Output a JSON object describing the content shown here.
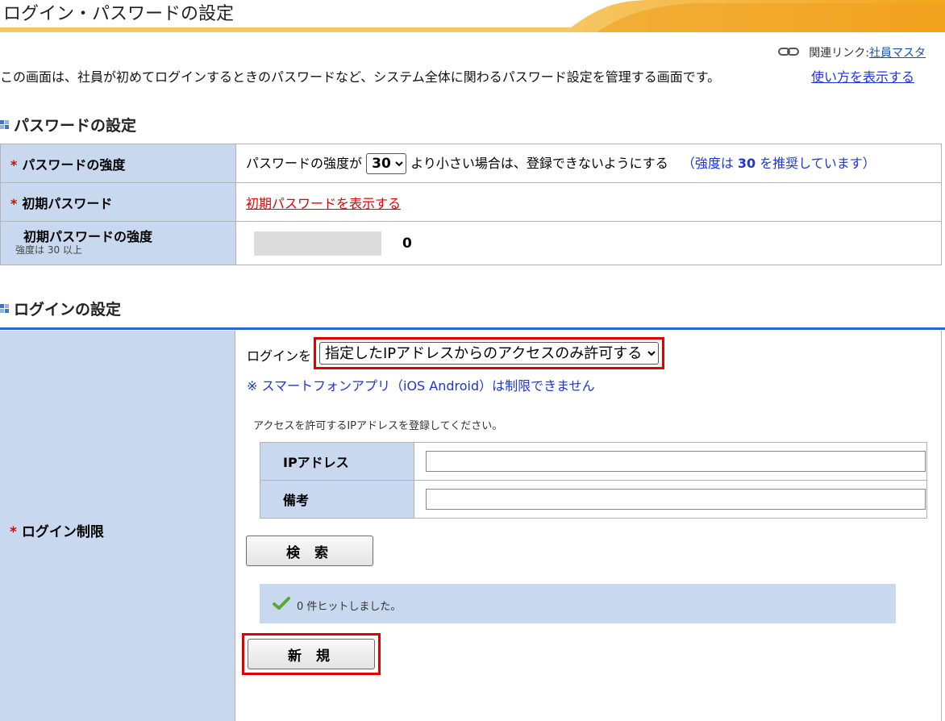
{
  "header": {
    "title": "ログイン・パスワードの設定"
  },
  "related": {
    "prefix": "関連リンク:",
    "link": "社員マスタ"
  },
  "description": "この画面は、社員が初めてログインするときのパスワードなど、システム全体に関わるパスワード設定を管理する画面です。",
  "howto_link": "使い方を表示する",
  "password_section": {
    "title": "パスワードの設定",
    "rows": {
      "strength": {
        "label": "パスワードの強度",
        "text_before": "パスワードの強度が",
        "select_value": "30",
        "text_after": "より小さい場合は、登録できないようにする",
        "recommend_before": "（強度は ",
        "recommend_value": "30",
        "recommend_after": " を推奨しています）"
      },
      "initial": {
        "label": "初期パスワード",
        "link": "初期パスワードを表示する"
      },
      "initial_strength": {
        "label": "初期パスワードの強度",
        "sublabel": "強度は 30 以上",
        "value": "0",
        "level": 0
      }
    }
  },
  "login_section": {
    "title": "ログインの設定",
    "label": "ログイン制限",
    "prefix": "ログインを",
    "select_value": "指定したIPアドレスからのアクセスのみ許可する",
    "note": "※ スマートフォンアプリ（iOS Android）は制限できません",
    "instruction": "アクセスを許可するIPアドレスを登録してください。",
    "fields": {
      "ip": "IPアドレス",
      "remarks": "備考"
    },
    "search_button": "検 索",
    "result_text": "0 件ヒットしました。",
    "new_button": "新 規"
  },
  "colors": {
    "accent_red": "#e00000",
    "label_bg": "#c8d8ee",
    "link_blue": "#1d34e0",
    "header_orange": "#f3a51c"
  }
}
